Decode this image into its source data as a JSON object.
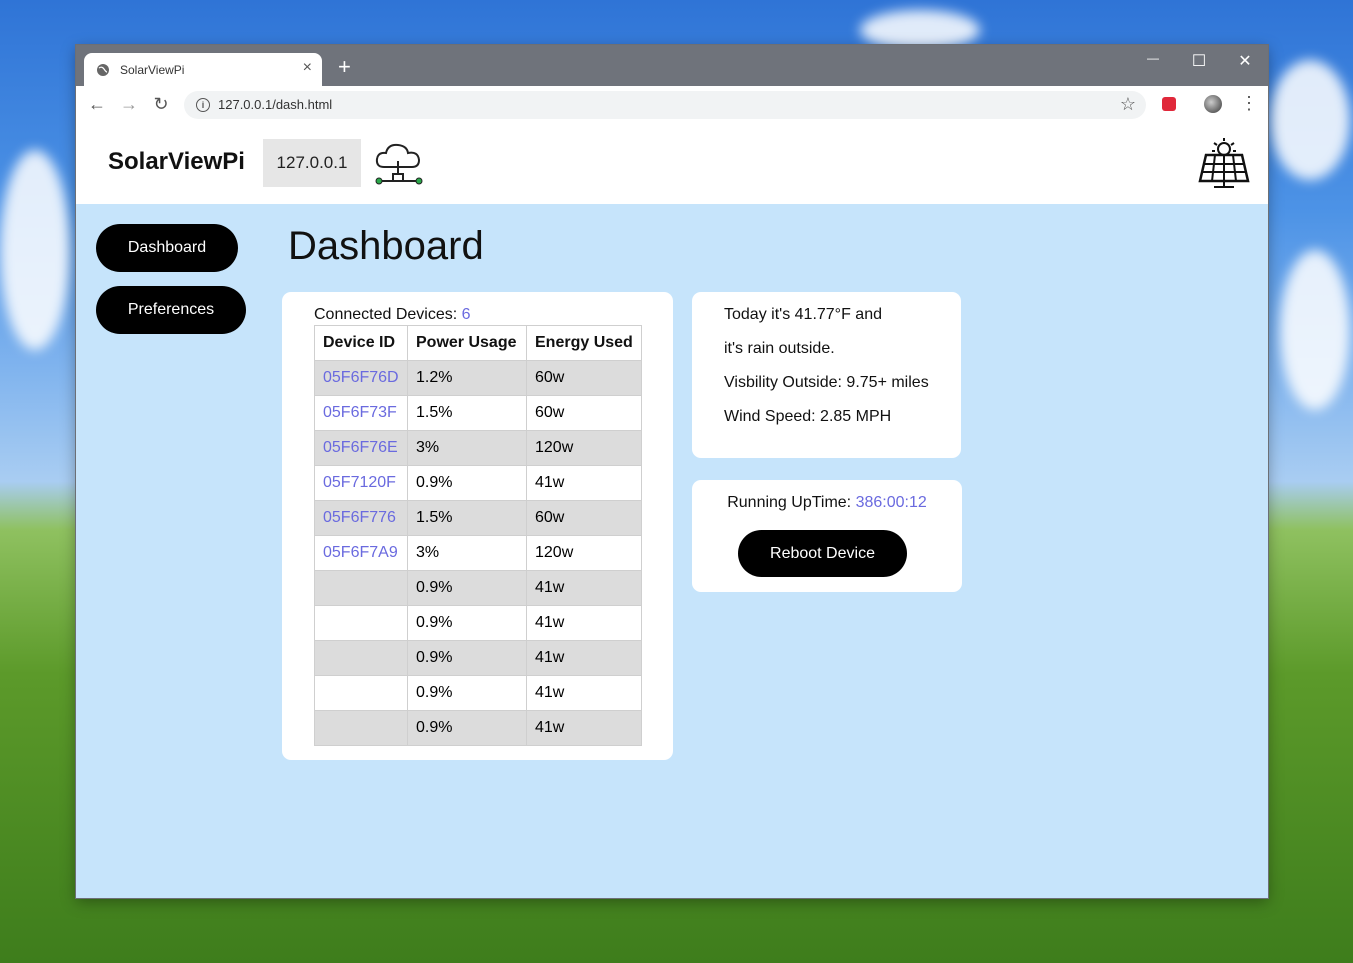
{
  "browser": {
    "tab_title": "SolarViewPi",
    "new_tab": "+",
    "url": "127.0.0.1/dash.html",
    "controls": {
      "minimize": "—",
      "maximize": "☐",
      "close": "✕"
    }
  },
  "header": {
    "brand": "SolarViewPi",
    "ip": "127.0.0.1"
  },
  "sidebar": {
    "items": [
      {
        "label": "Dashboard"
      },
      {
        "label": "Preferences"
      }
    ]
  },
  "main": {
    "title": "Dashboard",
    "devices": {
      "connected_label": "Connected Devices:",
      "connected_count": "6",
      "columns": [
        "Device ID",
        "Power Usage",
        "Energy Used"
      ],
      "rows": [
        {
          "id": "05F6F76D",
          "power": "1.2%",
          "energy": "60w"
        },
        {
          "id": "05F6F73F",
          "power": "1.5%",
          "energy": "60w"
        },
        {
          "id": "05F6F76E",
          "power": "3%",
          "energy": "120w"
        },
        {
          "id": "05F7120F",
          "power": "0.9%",
          "energy": "41w"
        },
        {
          "id": "05F6F776",
          "power": "1.5%",
          "energy": "60w"
        },
        {
          "id": "05F6F7A9",
          "power": "3%",
          "energy": "120w"
        },
        {
          "id": "",
          "power": "0.9%",
          "energy": "41w"
        },
        {
          "id": "",
          "power": "0.9%",
          "energy": "41w"
        },
        {
          "id": "",
          "power": "0.9%",
          "energy": "41w"
        },
        {
          "id": "",
          "power": "0.9%",
          "energy": "41w"
        },
        {
          "id": "",
          "power": "0.9%",
          "energy": "41w"
        }
      ]
    },
    "weather": {
      "line1": "Today it's 41.77°F and",
      "line2": "it's rain outside.",
      "line3": "Visbility Outside: 9.75+ miles",
      "line4": "Wind Speed: 2.85 MPH"
    },
    "status": {
      "uptime_label": "Running UpTime:",
      "uptime_value": "386:00:12",
      "reboot_label": "Reboot Device"
    }
  },
  "colors": {
    "page_bg": "#c6e4fb",
    "link": "#6a6adf",
    "button_bg": "#000000"
  }
}
